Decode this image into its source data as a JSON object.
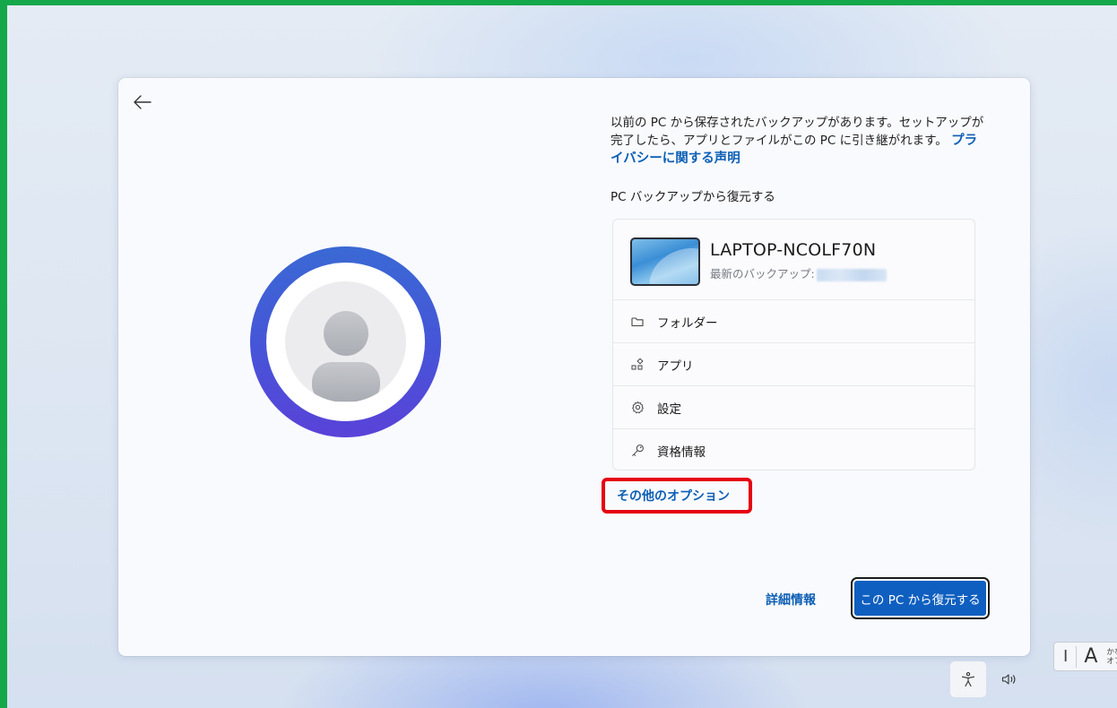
{
  "description": {
    "text": "以前の PC から保存されたバックアップがあります。セットアップが完了したら、アプリとファイルがこの PC に引き継がれます。",
    "privacy_link": "プライバシーに関する声明"
  },
  "section_title": "PC バックアップから復元する",
  "device": {
    "name": "LAPTOP-NCOLF70N",
    "last_backup_label": "最新のバックアップ:"
  },
  "backup_items": [
    {
      "label": "フォルダー",
      "icon": "folder-icon"
    },
    {
      "label": "アプリ",
      "icon": "apps-icon"
    },
    {
      "label": "設定",
      "icon": "gear-icon"
    },
    {
      "label": "資格情報",
      "icon": "key-icon"
    }
  ],
  "more_options_label": "その他のオプション",
  "details_label": "詳細情報",
  "restore_button_label": "この PC から復元する",
  "ime": {
    "caret": "I",
    "mode": "A",
    "kana_line1": "かな",
    "kana_line2": "オフ"
  },
  "colors": {
    "accent": "#0f5fc0",
    "link": "#0d5fb5",
    "highlight_box": "#e60012",
    "frame": "#14a84a"
  }
}
